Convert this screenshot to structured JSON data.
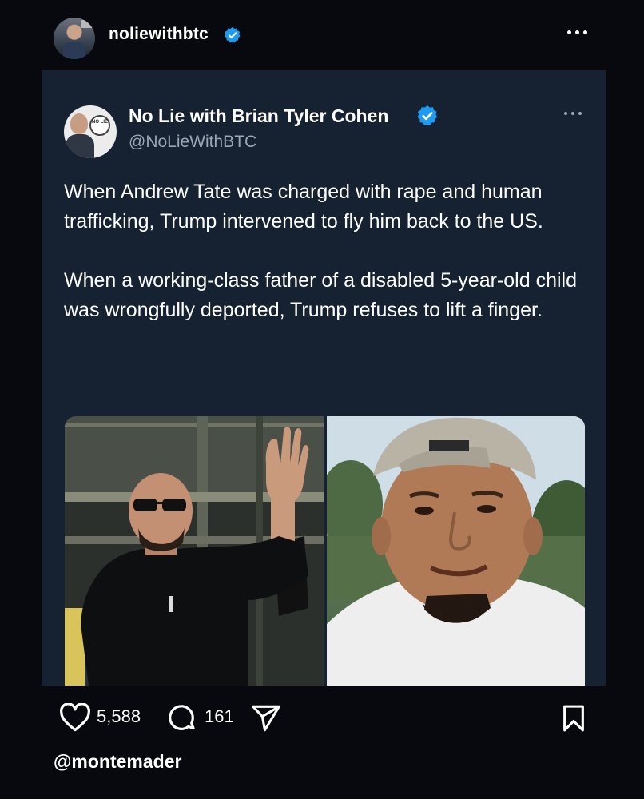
{
  "post": {
    "username": "noliewithbtc",
    "more_label": "More options"
  },
  "tweet": {
    "display_name": "No Lie with Brian Tyler Cohen",
    "handle": "@NoLieWithBTC",
    "avatar_logo_text": "NO LIE",
    "paragraphs": [
      "When Andrew Tate was charged with rape and human trafficking, Trump intervened to fly him back to the US.",
      "When a working-class father of a disabled 5-year-old child was wrongfully deported, Trump refuses to lift a finger."
    ],
    "media": [
      {
        "icon": "photo-man-waving-sunglasses"
      },
      {
        "icon": "photo-man-backwards-cap"
      }
    ]
  },
  "actions": {
    "likes": "5,588",
    "comments": "161"
  },
  "footer": {
    "credit": "@montemader"
  },
  "colors": {
    "background": "#07090e",
    "card": "#162231",
    "verified": "#1d9bf0",
    "secondary_text": "#9aa7b5"
  }
}
